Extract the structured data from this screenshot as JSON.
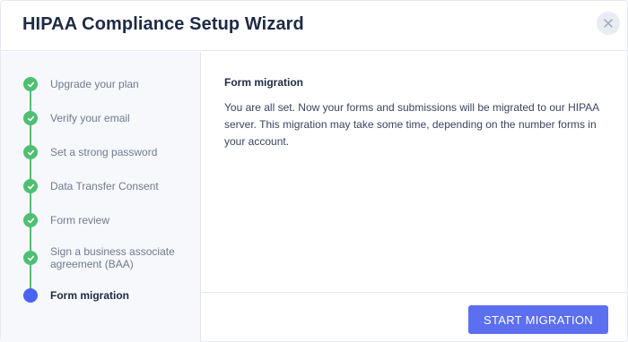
{
  "dialog": {
    "title": "HIPAA Compliance Setup Wizard",
    "close_icon": "close-icon"
  },
  "steps": [
    {
      "label": "Upgrade your plan",
      "status": "done"
    },
    {
      "label": "Verify your email",
      "status": "done"
    },
    {
      "label": "Set a strong password",
      "status": "done"
    },
    {
      "label": "Data Transfer Consent",
      "status": "done"
    },
    {
      "label": "Form review",
      "status": "done"
    },
    {
      "label": "Sign a business associate agreement (BAA)",
      "status": "done"
    },
    {
      "label": "Form migration",
      "status": "current"
    }
  ],
  "content": {
    "heading": "Form migration",
    "body": "You are all set. Now your forms and submissions will be migrated to our HIPAA server. This migration may take some time, depending on the number forms in your account."
  },
  "footer": {
    "start_label": "START MIGRATION"
  },
  "colors": {
    "accent": "#5b6ff0",
    "done": "#4fbf73",
    "current": "#4a63f0"
  }
}
